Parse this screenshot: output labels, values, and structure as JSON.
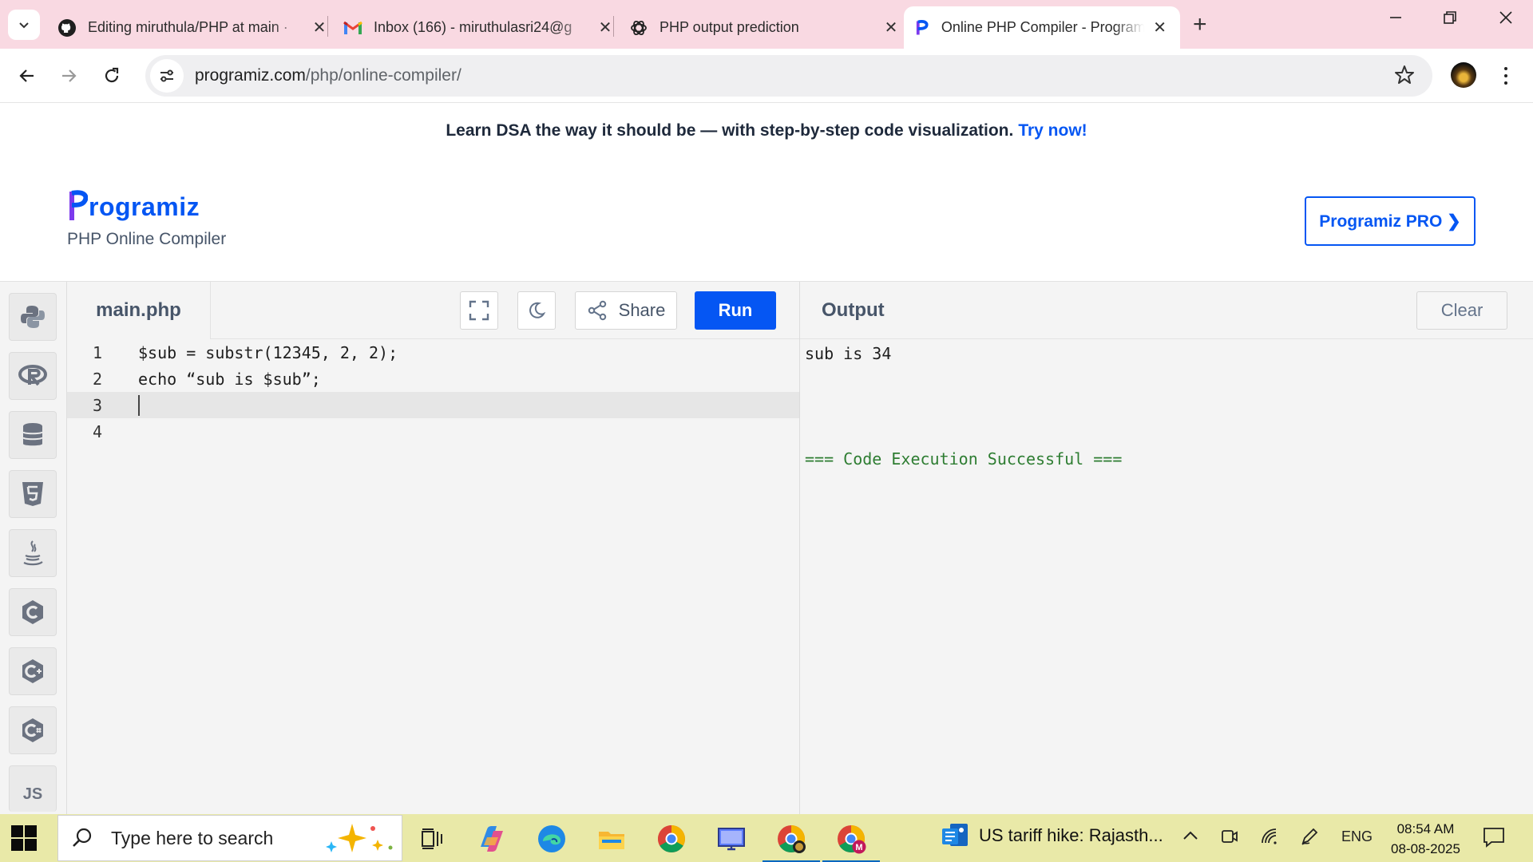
{
  "browser": {
    "tabs": [
      {
        "title": "Editing miruthula/PHP at main ·",
        "icon": "github-icon",
        "active": false
      },
      {
        "title": "Inbox (166) - miruthulasri24@g",
        "icon": "gmail-icon",
        "active": false
      },
      {
        "title": "PHP output prediction",
        "icon": "chatgpt-icon",
        "active": false
      },
      {
        "title": "Online PHP Compiler - Program",
        "icon": "programiz-icon",
        "active": true
      }
    ],
    "url_domain": "programiz.com",
    "url_path": "/php/online-compiler/"
  },
  "banner": {
    "text": "Learn DSA the way it should be — with step-by-step code visualization.",
    "link": "Try now!"
  },
  "brand": {
    "logo_text": "rogramiz",
    "subtitle": "PHP Online Compiler",
    "pro_button": "Programiz PRO ❯"
  },
  "sidebar": {
    "languages": [
      "python-icon",
      "r-icon",
      "sql-icon",
      "html5-icon",
      "java-icon",
      "c-icon",
      "cplusplus-icon",
      "csharp-icon",
      "js-icon"
    ],
    "js_label": "JS"
  },
  "editor": {
    "filename": "main.php",
    "share_label": "Share",
    "run_label": "Run",
    "lines": [
      {
        "num": "1",
        "code": "$sub = substr(12345, 2, 2);"
      },
      {
        "num": "2",
        "code": "echo “sub is $sub”;"
      },
      {
        "num": "3",
        "code": ""
      },
      {
        "num": "4",
        "code": ""
      }
    ],
    "current_line": 3
  },
  "output": {
    "title": "Output",
    "clear_label": "Clear",
    "lines": [
      "sub is 34",
      "=== Code Execution Successful ==="
    ]
  },
  "taskbar": {
    "search_placeholder": "Type here to search",
    "news": "US tariff hike: Rajasth...",
    "language": "ENG",
    "time": "08:54 AM",
    "date": "08-08-2025"
  },
  "colors": {
    "accent": "#0556f3",
    "tabstrip": "#f9d9e2",
    "taskbar": "#e9e9a8",
    "success": "#2e7d32"
  }
}
